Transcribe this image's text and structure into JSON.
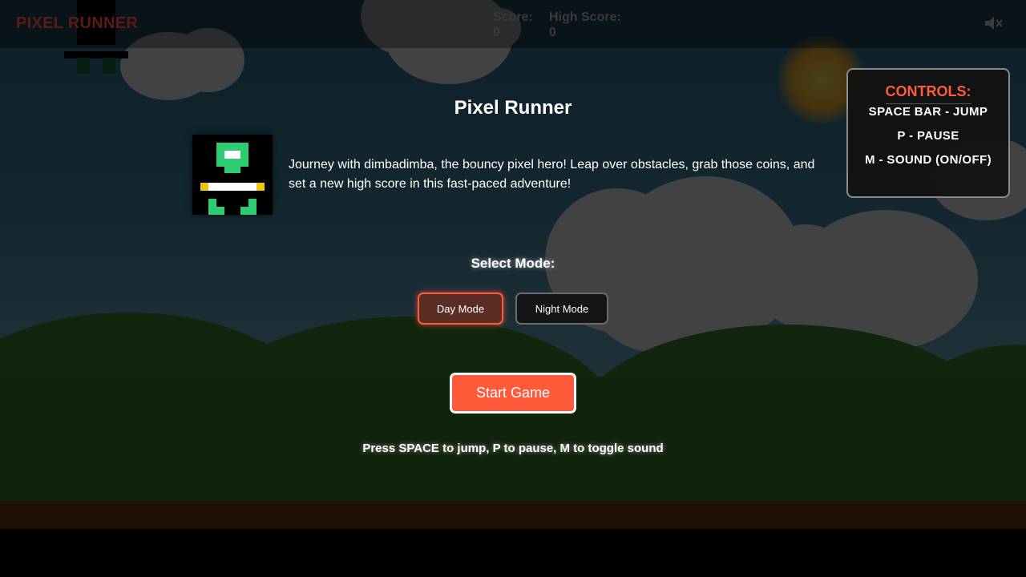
{
  "hud": {
    "title": "PIXEL RUNNER",
    "score_label": "Score:",
    "score_value": "0",
    "high_score_label": "High Score:",
    "high_score_value": "0",
    "sound_icon": "speaker-muted-icon"
  },
  "menu": {
    "title": "Pixel Runner",
    "intro": "Journey with dimbadimba, the bouncy pixel hero! Leap over obstacles, grab those coins, and set a new high score in this fast-paced adventure!",
    "select_mode_label": "Select Mode:",
    "modes": [
      {
        "label": "Day Mode",
        "selected": true
      },
      {
        "label": "Night Mode",
        "selected": false
      }
    ],
    "start_label": "Start Game",
    "hint": "Press SPACE to jump, P to pause, M to toggle sound"
  },
  "controls": {
    "title": "CONTROLS:",
    "lines": [
      "SPACE BAR - JUMP",
      "P - PAUSE",
      "M - SOUND (ON/OFF)"
    ]
  },
  "colors": {
    "accent": "#ff5a3a",
    "hero_green": "#2ecc71",
    "hero_yellow": "#f1c40f"
  }
}
